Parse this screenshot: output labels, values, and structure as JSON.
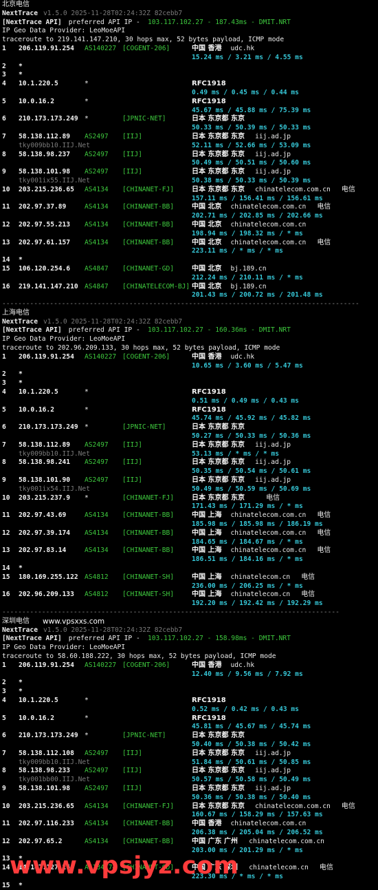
{
  "sections": [
    {
      "title": "北京电信",
      "site_label": "",
      "header": {
        "tool": "NextTrace",
        "version": "v1.5.0 2025-11-28T02:24:32Z 82cebb7",
        "api_tag": "[NextTrace API]",
        "api_text": " preferred API IP - ",
        "api_detail": "103.117.102.27 - 187.43ms - DMIT.NRT",
        "geo_provider": "IP Geo Data Provider: LeoMoeAPI",
        "traceroute": "traceroute to 219.141.147.210, 30 hops max, 52 bytes payload, ICMP mode"
      },
      "hops": [
        {
          "n": "1",
          "ip": "206.119.91.254",
          "asn": "AS140227",
          "tag": "[COGENT-206]",
          "geo": "中国 香港",
          "domain": "udc.hk",
          "isp": "",
          "rdns": "",
          "rtt": "15.24 ms / 3.21 ms / 4.55 ms"
        },
        {
          "n": "2",
          "ip": "*"
        },
        {
          "n": "3",
          "ip": "*"
        },
        {
          "n": "4",
          "ip": "10.1.220.5",
          "asn": "*",
          "tag": "",
          "geo": "RFC1918",
          "domain": "",
          "isp": "",
          "rdns": "",
          "rtt": "0.49 ms / 0.45 ms / 0.44 ms"
        },
        {
          "n": "5",
          "ip": "10.0.16.2",
          "asn": "*",
          "tag": "",
          "geo": "RFC1918",
          "domain": "",
          "isp": "",
          "rdns": "",
          "rtt": "45.67 ms / 45.88 ms / 75.39 ms"
        },
        {
          "n": "6",
          "ip": "210.173.173.249",
          "asn": "*",
          "tag": "[JPNIC-NET]",
          "geo": "日本 东京都 东京",
          "domain": "",
          "isp": "",
          "rdns": "",
          "rtt": "50.33 ms / 50.39 ms / 50.33 ms"
        },
        {
          "n": "7",
          "ip": "58.138.112.89",
          "asn": "AS2497",
          "tag": "[IIJ]",
          "geo": "日本 东京都 东京",
          "domain": "iij.ad.jp",
          "isp": "",
          "rdns": "tky009bb10.IIJ.Net",
          "rtt": "52.11 ms / 52.66 ms / 53.09 ms"
        },
        {
          "n": "8",
          "ip": "58.138.98.237",
          "asn": "AS2497",
          "tag": "[IIJ]",
          "geo": "日本 东京都 东京",
          "domain": "iij.ad.jp",
          "isp": "",
          "rdns": "",
          "rtt": "50.49 ms / 50.51 ms / 50.60 ms"
        },
        {
          "n": "9",
          "ip": "58.138.101.98",
          "asn": "AS2497",
          "tag": "[IIJ]",
          "geo": "日本 东京都 东京",
          "domain": "iij.ad.jp",
          "isp": "",
          "rdns": "tky001ix55.IIJ.Net",
          "rtt": "50.38 ms / 50.33 ms / 50.39 ms"
        },
        {
          "n": "10",
          "ip": "203.215.236.65",
          "asn": "AS4134",
          "tag": "[CHINANET-FJ]",
          "geo": "日本 东京都 东京",
          "domain": "chinatelecom.com.cn",
          "isp": "电信",
          "rdns": "",
          "rtt": "157.11 ms / 156.41 ms / 156.61 ms"
        },
        {
          "n": "11",
          "ip": "202.97.37.89",
          "asn": "AS4134",
          "tag": "[CHINANET-BB]",
          "geo": "中国 北京",
          "domain": "chinatelecom.com.cn",
          "isp": "电信",
          "rdns": "",
          "rtt": "202.71 ms / 202.85 ms / 202.66 ms"
        },
        {
          "n": "12",
          "ip": "202.97.55.213",
          "asn": "AS4134",
          "tag": "[CHINANET-BB]",
          "geo": "中国 北京",
          "domain": "chinatelecom.com.cn",
          "isp": "",
          "rdns": "",
          "rtt": "198.94 ms / 198.32 ms / * ms"
        },
        {
          "n": "13",
          "ip": "202.97.61.157",
          "asn": "AS4134",
          "tag": "[CHINANET-BB]",
          "geo": "中国 北京",
          "domain": "chinatelecom.com.cn",
          "isp": "电信",
          "rdns": "",
          "rtt": "223.11 ms / * ms / * ms"
        },
        {
          "n": "14",
          "ip": "*"
        },
        {
          "n": "15",
          "ip": "106.120.254.6",
          "asn": "AS4847",
          "tag": "[CHINANET-GD]",
          "geo": "中国 北京",
          "domain": "bj.189.cn",
          "isp": "",
          "rdns": "",
          "rtt": "212.24 ms / 210.11 ms / * ms"
        },
        {
          "n": "16",
          "ip": "219.141.147.210",
          "asn": "AS4847",
          "tag": "[CHINATELECOM-BJ]",
          "geo": "中国 北京",
          "domain": "bj.189.cn",
          "isp": "",
          "rdns": "",
          "rtt": "201.43 ms / 200.72 ms / 201.48 ms"
        }
      ]
    },
    {
      "title": "上海电信",
      "site_label": "",
      "header": {
        "tool": "NextTrace",
        "version": "v1.5.0 2025-11-28T02:24:32Z 82cebb7",
        "api_tag": "[NextTrace API]",
        "api_text": " preferred API IP - ",
        "api_detail": "103.117.102.27 - 160.36ms - DMIT.NRT",
        "geo_provider": "IP Geo Data Provider: LeoMoeAPI",
        "traceroute": "traceroute to 202.96.209.133, 30 hops max, 52 bytes payload, ICMP mode"
      },
      "hops": [
        {
          "n": "1",
          "ip": "206.119.91.254",
          "asn": "AS140227",
          "tag": "[COGENT-206]",
          "geo": "中国 香港",
          "domain": "udc.hk",
          "isp": "",
          "rdns": "",
          "rtt": "10.65 ms / 3.60 ms / 5.47 ms"
        },
        {
          "n": "2",
          "ip": "*"
        },
        {
          "n": "3",
          "ip": "*"
        },
        {
          "n": "4",
          "ip": "10.1.220.5",
          "asn": "*",
          "tag": "",
          "geo": "RFC1918",
          "domain": "",
          "isp": "",
          "rdns": "",
          "rtt": "0.51 ms / 0.49 ms / 0.43 ms"
        },
        {
          "n": "5",
          "ip": "10.0.16.2",
          "asn": "*",
          "tag": "",
          "geo": "RFC1918",
          "domain": "",
          "isp": "",
          "rdns": "",
          "rtt": "45.74 ms / 45.92 ms / 45.82 ms"
        },
        {
          "n": "6",
          "ip": "210.173.173.249",
          "asn": "*",
          "tag": "[JPNIC-NET]",
          "geo": "日本 东京都 东京",
          "domain": "",
          "isp": "",
          "rdns": "",
          "rtt": "50.27 ms / 50.33 ms / 50.36 ms"
        },
        {
          "n": "7",
          "ip": "58.138.112.89",
          "asn": "AS2497",
          "tag": "[IIJ]",
          "geo": "日本 东京都 东京",
          "domain": "iij.ad.jp",
          "isp": "",
          "rdns": "tky009bb10.IIJ.Net",
          "rtt": "53.13 ms / * ms / * ms"
        },
        {
          "n": "8",
          "ip": "58.138.98.241",
          "asn": "AS2497",
          "tag": "[IIJ]",
          "geo": "日本 东京都 东京",
          "domain": "iij.ad.jp",
          "isp": "",
          "rdns": "",
          "rtt": "50.35 ms / 50.54 ms / 50.61 ms"
        },
        {
          "n": "9",
          "ip": "58.138.101.90",
          "asn": "AS2497",
          "tag": "[IIJ]",
          "geo": "日本 东京都 东京",
          "domain": "iij.ad.jp",
          "isp": "",
          "rdns": "tky001ix54.IIJ.Net",
          "rtt": "50.49 ms / 50.59 ms / 50.69 ms"
        },
        {
          "n": "10",
          "ip": "203.215.237.9",
          "asn": "*",
          "tag": "[CHINANET-FJ]",
          "geo": "日本 东京都 东京",
          "domain": "",
          "isp": "电信",
          "rdns": "",
          "rtt": "171.43 ms / 171.29 ms / * ms"
        },
        {
          "n": "11",
          "ip": "202.97.43.69",
          "asn": "AS4134",
          "tag": "[CHINANET-BB]",
          "geo": "中国 上海",
          "domain": "chinatelecom.com.cn",
          "isp": "电信",
          "rdns": "",
          "rtt": "185.98 ms / 185.98 ms / 186.19 ms"
        },
        {
          "n": "12",
          "ip": "202.97.39.174",
          "asn": "AS4134",
          "tag": "[CHINANET-BB]",
          "geo": "中国 上海",
          "domain": "chinatelecom.com.cn",
          "isp": "电信",
          "rdns": "",
          "rtt": "184.65 ms / 184.67 ms / * ms"
        },
        {
          "n": "13",
          "ip": "202.97.83.14",
          "asn": "AS4134",
          "tag": "[CHINANET-BB]",
          "geo": "中国 上海",
          "domain": "chinatelecom.com.cn",
          "isp": "电信",
          "rdns": "",
          "rtt": "186.51 ms / 184.16 ms / * ms"
        },
        {
          "n": "14",
          "ip": "*"
        },
        {
          "n": "15",
          "ip": "180.169.255.122",
          "asn": "AS4812",
          "tag": "[CHINANET-SH]",
          "geo": "中国 上海",
          "domain": "chinatelecom.cn",
          "isp": "电信",
          "rdns": "",
          "rtt": "236.00 ms / 206.25 ms / * ms"
        },
        {
          "n": "16",
          "ip": "202.96.209.133",
          "asn": "AS4812",
          "tag": "[CHINANET-SH]",
          "geo": "中国 上海",
          "domain": "chinatelecom.cn",
          "isp": "电信",
          "rdns": "",
          "rtt": "192.20 ms / 192.42 ms / 192.29 ms"
        }
      ]
    },
    {
      "title": "深圳电信",
      "site_label": "www.vpsxxs.com",
      "header": {
        "tool": "NextTrace",
        "version": "v1.5.0 2025-11-28T02:24:32Z 82cebb7",
        "api_tag": "[NextTrace API]",
        "api_text": " preferred API IP - ",
        "api_detail": "103.117.102.27 - 158.98ms - DMIT.NRT",
        "geo_provider": "IP Geo Data Provider: LeoMoeAPI",
        "traceroute": "traceroute to 58.60.188.222, 30 hops max, 52 bytes payload, ICMP mode"
      },
      "hops": [
        {
          "n": "1",
          "ip": "206.119.91.254",
          "asn": "AS140227",
          "tag": "[COGENT-206]",
          "geo": "中国 香港",
          "domain": "udc.hk",
          "isp": "",
          "rdns": "",
          "rtt": "12.40 ms / 9.56 ms / 7.92 ms"
        },
        {
          "n": "2",
          "ip": "*"
        },
        {
          "n": "3",
          "ip": "*"
        },
        {
          "n": "4",
          "ip": "10.1.220.5",
          "asn": "*",
          "tag": "",
          "geo": "RFC1918",
          "domain": "",
          "isp": "",
          "rdns": "",
          "rtt": "0.52 ms / 0.42 ms / 0.43 ms"
        },
        {
          "n": "5",
          "ip": "10.0.16.2",
          "asn": "*",
          "tag": "",
          "geo": "RFC1918",
          "domain": "",
          "isp": "",
          "rdns": "",
          "rtt": "45.81 ms / 45.67 ms / 45.74 ms"
        },
        {
          "n": "6",
          "ip": "210.173.173.249",
          "asn": "*",
          "tag": "[JPNIC-NET]",
          "geo": "日本 东京都 东京",
          "domain": "",
          "isp": "",
          "rdns": "",
          "rtt": "50.40 ms / 50.38 ms / 50.42 ms"
        },
        {
          "n": "7",
          "ip": "58.138.112.108",
          "asn": "AS2497",
          "tag": "[IIJ]",
          "geo": "日本 东京都 东京",
          "domain": "iij.ad.jp",
          "isp": "",
          "rdns": "tky009bb10.IIJ.Net",
          "rtt": "51.84 ms / 50.61 ms / 50.85 ms"
        },
        {
          "n": "8",
          "ip": "58.138.98.233",
          "asn": "AS2497",
          "tag": "[IIJ]",
          "geo": "日本 东京都 东京",
          "domain": "iij.ad.jp",
          "isp": "",
          "rdns": "tky001bb00.IIJ.Net",
          "rtt": "50.57 ms / 50.58 ms / 50.49 ms"
        },
        {
          "n": "9",
          "ip": "58.138.101.98",
          "asn": "AS2497",
          "tag": "[IIJ]",
          "geo": "日本 东京都 东京",
          "domain": "iij.ad.jp",
          "isp": "",
          "rdns": "",
          "rtt": "50.36 ms / 50.38 ms / 50.40 ms"
        },
        {
          "n": "10",
          "ip": "203.215.236.65",
          "asn": "AS4134",
          "tag": "[CHINANET-FJ]",
          "geo": "日本 东京都 东京",
          "domain": "chinatelecom.com.cn",
          "isp": "电信",
          "rdns": "",
          "rtt": "160.67 ms / 158.29 ms / 157.63 ms"
        },
        {
          "n": "11",
          "ip": "202.97.116.233",
          "asn": "AS4134",
          "tag": "[CHINANET-BB]",
          "geo": "中国 香港",
          "domain": "chinatelecom.com.cn",
          "isp": "",
          "rdns": "",
          "rtt": "206.38 ms / 205.04 ms / 206.52 ms"
        },
        {
          "n": "12",
          "ip": "202.97.65.2",
          "asn": "AS4134",
          "tag": "[CHINANET-BB]",
          "geo": "中国 广东 广州",
          "domain": "chinatelecom.com.cn",
          "isp": "",
          "rdns": "",
          "rtt": "203.00 ms / 201.29 ms / * ms"
        },
        {
          "n": "13",
          "ip": "*"
        },
        {
          "n": "14",
          "ip": "14.147.127.26",
          "asn": "AS134774",
          "tag": "[CHINANET-GD]",
          "geo": "中国 广东 深圳",
          "domain": "chinatelecom.cn",
          "isp": "电信",
          "rdns": "",
          "rtt": "223.30 ms / * ms / * ms"
        },
        {
          "n": "15",
          "ip": "*"
        }
      ]
    }
  ],
  "watermark": "www.vpsjyz.com",
  "colors": {
    "background": "#000000",
    "green": "#3ec93e",
    "cyan": "#36c6d6",
    "yellow": "#e8e84a",
    "gray": "#7a7a7a",
    "watermark": "#ff3b3b"
  }
}
